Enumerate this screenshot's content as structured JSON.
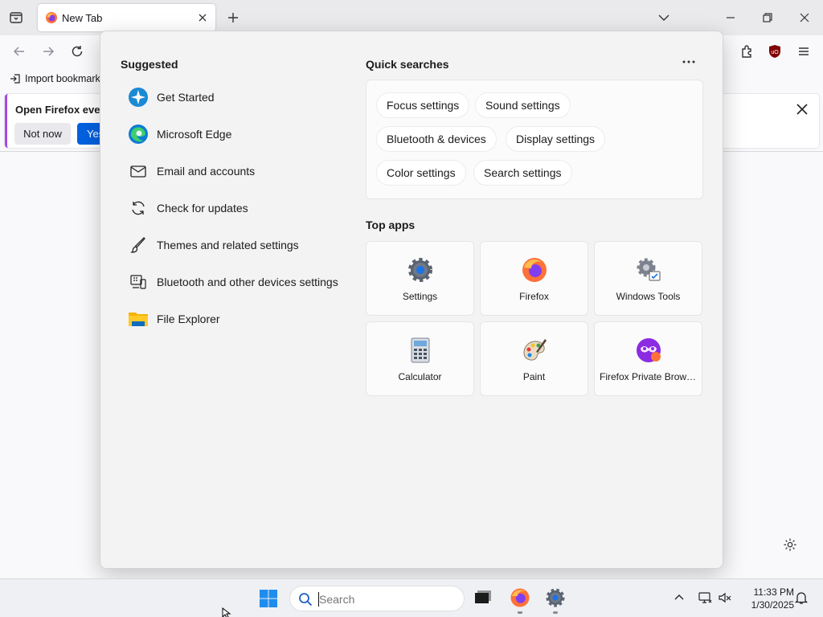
{
  "browser": {
    "tab_title": "New Tab",
    "bookmark_import": "Import bookmarks...",
    "notification_text": "Open Firefox every",
    "not_now": "Not now",
    "yes": "Yes"
  },
  "start_panel": {
    "suggested_title": "Suggested",
    "suggested": [
      {
        "label": "Get Started",
        "icon": "get-started-icon"
      },
      {
        "label": "Microsoft Edge",
        "icon": "edge-icon"
      },
      {
        "label": "Email and accounts",
        "icon": "mail-icon"
      },
      {
        "label": "Check for updates",
        "icon": "refresh-icon"
      },
      {
        "label": "Themes and related settings",
        "icon": "brush-icon"
      },
      {
        "label": "Bluetooth and other devices settings",
        "icon": "devices-icon"
      },
      {
        "label": "File Explorer",
        "icon": "folder-icon"
      }
    ],
    "quick_title": "Quick searches",
    "quick": [
      "Focus settings",
      "Sound settings",
      "Bluetooth & devices",
      "Display settings",
      "Color settings",
      "Search settings"
    ],
    "top_apps_title": "Top apps",
    "top_apps": [
      {
        "label": "Settings",
        "icon": "settings-icon"
      },
      {
        "label": "Firefox",
        "icon": "firefox-icon"
      },
      {
        "label": "Windows Tools",
        "icon": "windows-tools-icon"
      },
      {
        "label": "Calculator",
        "icon": "calculator-icon"
      },
      {
        "label": "Paint",
        "icon": "paint-icon"
      },
      {
        "label": "Firefox Private Browsing",
        "icon": "firefox-private-icon"
      }
    ]
  },
  "taskbar": {
    "search_placeholder": "Search",
    "time": "11:33 PM",
    "date": "1/30/2025"
  },
  "colors": {
    "accent": "#0061e0",
    "panel_bg": "#f3f3f3",
    "taskbar_bg": "#eef0f4"
  }
}
